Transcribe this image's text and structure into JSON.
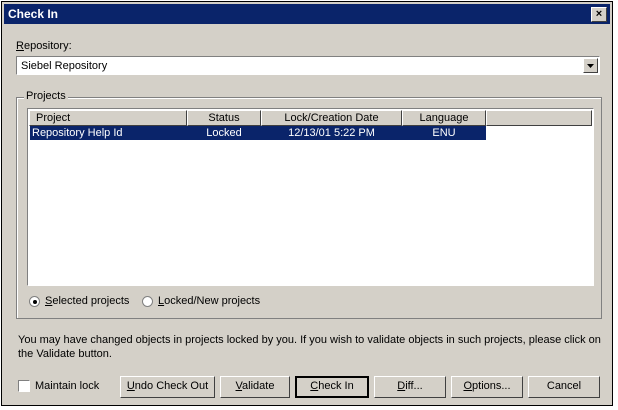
{
  "window": {
    "title": "Check In",
    "close_glyph": "×"
  },
  "repository": {
    "label_prefix": "R",
    "label_rest": "epository:",
    "value": "Siebel Repository"
  },
  "projects": {
    "group_label": "Projects",
    "columns": [
      "Project",
      "Status",
      "Lock/Creation Date",
      "Language"
    ],
    "rows": [
      {
        "project": "Repository Help Id",
        "status": "Locked",
        "date": "12/13/01 5:22 PM",
        "language": "ENU"
      }
    ],
    "filter": {
      "selected_label_prefix": "S",
      "selected_label_rest": "elected projects",
      "locked_label_prefix": "L",
      "locked_label_rest": "ocked/New projects",
      "selected": "selected"
    }
  },
  "message": "You may have changed objects in projects locked by you. If you wish to validate objects in such projects, please click on the Validate button.",
  "maintain_lock": {
    "label": "Maintain lock",
    "checked": false
  },
  "buttons": {
    "undo_prefix": "U",
    "undo_rest": "ndo Check Out",
    "validate_prefix": "V",
    "validate_rest": "alidate",
    "checkin_prefix": "C",
    "checkin_rest": "heck In",
    "diff_prefix": "D",
    "diff_rest": "iff...",
    "options_prefix": "O",
    "options_rest": "ptions...",
    "cancel": "Cancel"
  },
  "colors": {
    "title_bar": "#0a246a",
    "face": "#d4d0c8",
    "selection": "#0a246a"
  }
}
